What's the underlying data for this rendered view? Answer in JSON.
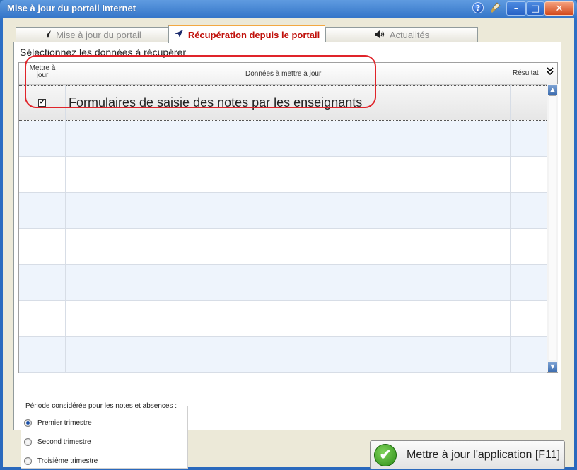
{
  "window": {
    "title": "Mise à jour du portail Internet",
    "help_glyph": "?",
    "min_glyph": "–",
    "max_glyph": "□",
    "close_glyph": "✕",
    "titlebar_color": "#2d6fc4"
  },
  "tabs": [
    {
      "label": "Mise à jour du portail",
      "icon": "send-arrow-icon",
      "active": false
    },
    {
      "label": "Récupération depuis le portail",
      "icon": "receive-arrow-icon",
      "active": true
    },
    {
      "label": "Actualités",
      "icon": "speaker-icon",
      "active": false
    }
  ],
  "section_title": "Sélectionnez les données à récupérer",
  "grid": {
    "columns": [
      "Mettre à jour",
      "Données à mettre à jour",
      "Résultat"
    ],
    "rows": [
      {
        "checked": true,
        "label": "Formulaires de saisie des notes par les enseignants",
        "result": ""
      }
    ]
  },
  "period": {
    "legend": "Période considérée pour les notes et absences :",
    "options": [
      "Premier trimestre",
      "Second trimestre",
      "Troisième trimestre"
    ],
    "selected": "Premier trimestre"
  },
  "apply_button": {
    "label": "Mettre à jour l'application [F11]"
  },
  "colors": {
    "active_tab_text": "#c0100a",
    "highlight_ring": "#e0242a",
    "alt_row": "#eef4fc"
  }
}
